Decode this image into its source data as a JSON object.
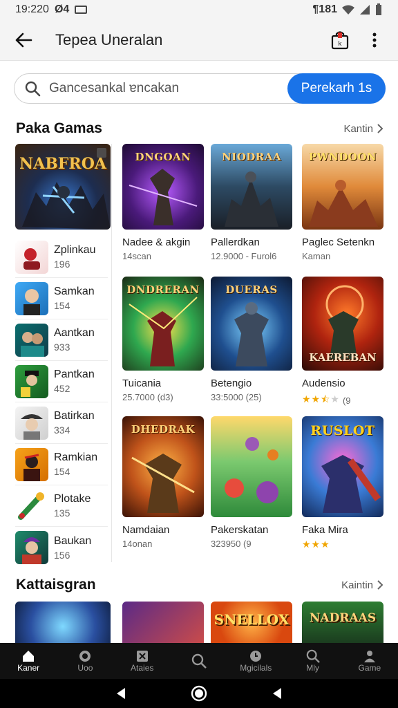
{
  "status_bar": {
    "time": "19:220",
    "left_extra": "Ø4",
    "right_text": "¶181"
  },
  "app_bar": {
    "title": "Tepea Uneralan"
  },
  "search": {
    "placeholder": "Gancesankal ɐncakan",
    "button_label": "Perekarh 1s"
  },
  "sections": [
    {
      "title": "Paka Gamas",
      "link": "Kantin"
    },
    {
      "title": "Kattaisgran",
      "link": "Kaintin"
    }
  ],
  "featured": {
    "art_title": "NABFROA"
  },
  "side_list": [
    {
      "name": "Zplinkau",
      "sub": "196"
    },
    {
      "name": "Samkan",
      "sub": "154"
    },
    {
      "name": "Aantkan",
      "sub": "933"
    },
    {
      "name": "Pantkan",
      "sub": "452"
    },
    {
      "name": "Batirkan",
      "sub": "334"
    },
    {
      "name": "Ramkian",
      "sub": "154"
    },
    {
      "name": "Plotake",
      "sub": "135"
    },
    {
      "name": "Baukan",
      "sub": "156"
    }
  ],
  "cards": [
    {
      "art": "DNGOAN",
      "title": "Nadee & akgin",
      "sub": "14scan"
    },
    {
      "art": "NIODRAA",
      "title": "Pallerdkan",
      "sub": "12.9000 - Furol6"
    },
    {
      "art": "PWNDOON",
      "title": "Paglec Setenkn",
      "sub": "Kaman"
    },
    {
      "art": "DNDRERAN",
      "title": "Tuicania",
      "sub": "25.7000 (d3)"
    },
    {
      "art": "DUERAS",
      "title": "Betengio",
      "sub": "33:5000 (25)"
    },
    {
      "art": "KAEREBAN",
      "title": "Audensio",
      "sub": "(9",
      "rating": 2.5
    },
    {
      "art": "DHEDRAK",
      "title": "Namdaian",
      "sub": "14onan"
    },
    {
      "art": "",
      "title": "Pakerskatan",
      "sub": "323950 (9"
    },
    {
      "art": "RUSLOT",
      "title": "Faka Mira",
      "sub": "",
      "rating": 3
    }
  ],
  "row2_art": [
    "",
    "",
    "SNELLOX",
    "NADRAAS"
  ],
  "bottom_nav": [
    {
      "label": "Kaner",
      "icon": "home-icon"
    },
    {
      "label": "Uoo",
      "icon": "badge-icon"
    },
    {
      "label": "Ataies",
      "icon": "grid-icon"
    },
    {
      "label": "",
      "icon": "search-icon"
    },
    {
      "label": "Mgicilals",
      "icon": "clock-icon"
    },
    {
      "label": "Mly",
      "icon": "search-icon"
    },
    {
      "label": "Game",
      "icon": "person-icon"
    }
  ],
  "colors": {
    "accent": "#1a73e8",
    "nav_bg": "#111111",
    "star": "#f0a500"
  }
}
